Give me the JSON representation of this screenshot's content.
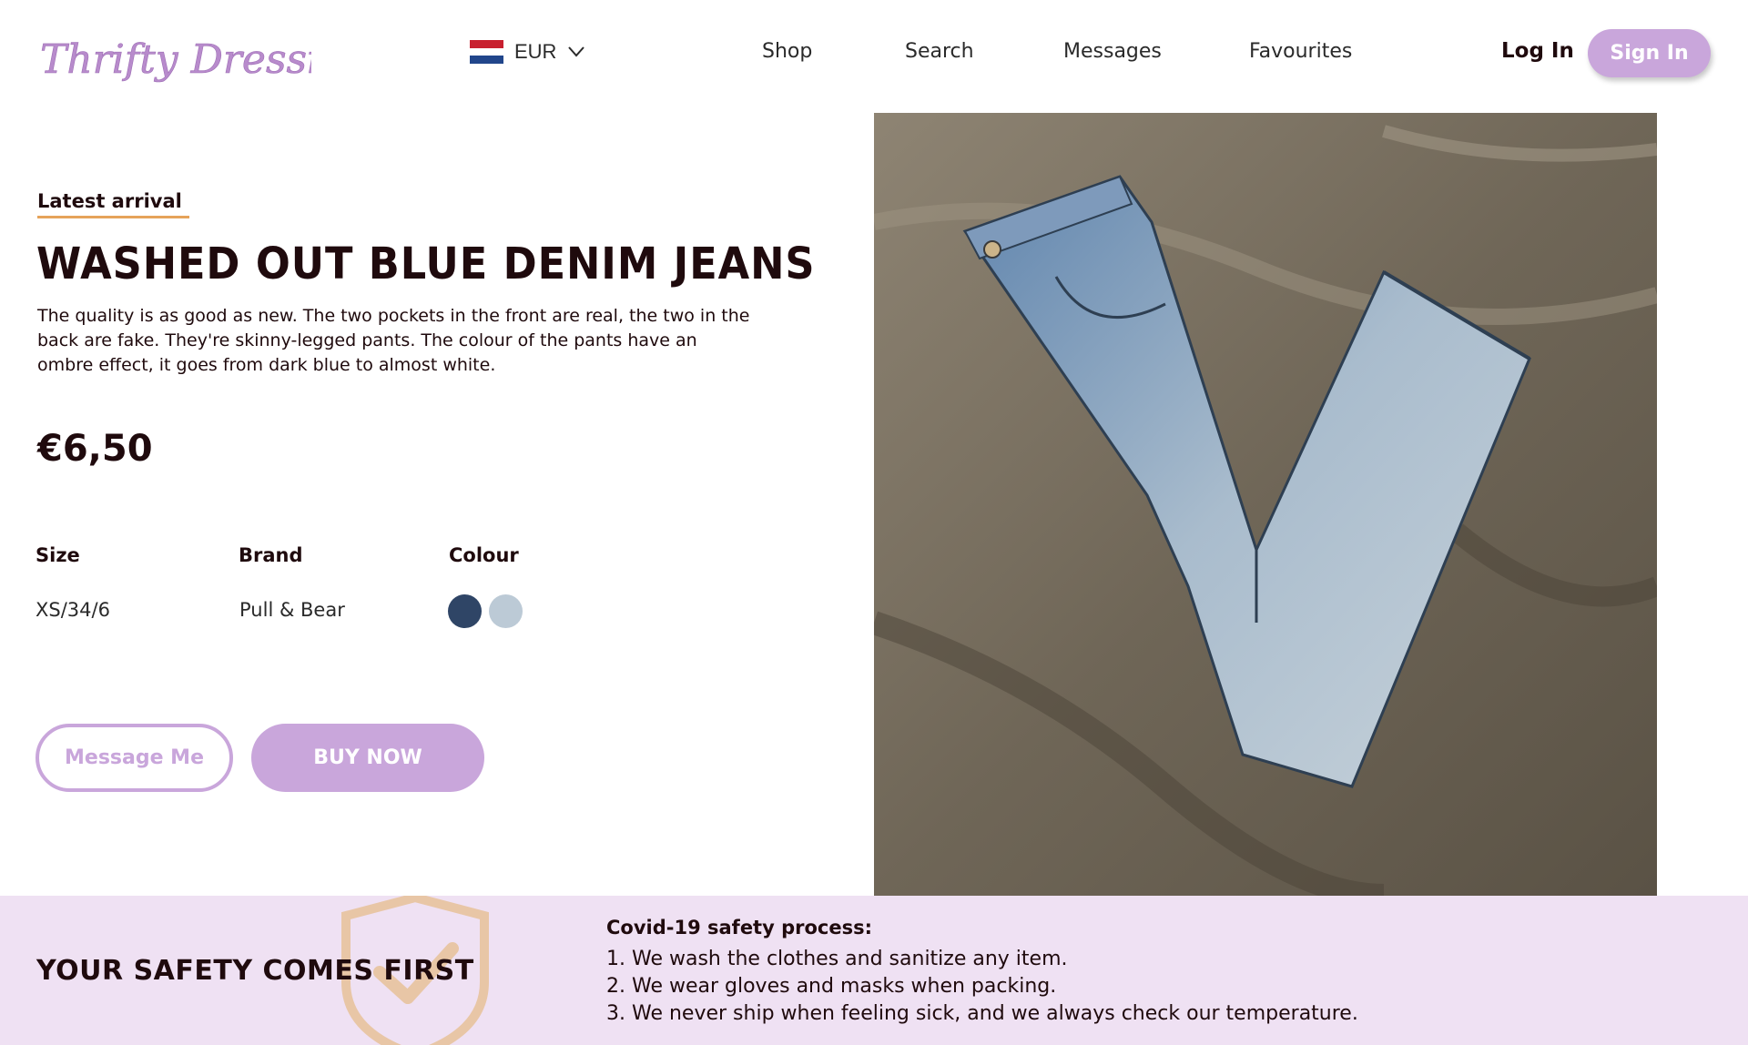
{
  "brand": {
    "logo_text": "Thrifty Dressing",
    "accent": "#c9a6db",
    "underline": "#e6a35a",
    "shield": "#e8c6a6"
  },
  "header": {
    "currency": {
      "label": "EUR",
      "flag": "netherlands-flag"
    },
    "nav": [
      "Shop",
      "Search",
      "Messages",
      "Favourites"
    ],
    "login_label": "Log In",
    "signin_label": "Sign In"
  },
  "product": {
    "tag": "Latest arrival",
    "title": "WASHED OUT BLUE DENIM JEANS",
    "description": "The quality is as good as new. The two pockets in the front are real, the two in the back are fake. They're skinny-legged pants. The colour of the pants have an ombre effect, it goes from dark blue to almost white.",
    "price": "€6,50",
    "attributes": {
      "size_label": "Size",
      "size_value": "XS/34/6",
      "brand_label": "Brand",
      "brand_value": "Pull & Bear",
      "colour_label": "Colour",
      "colours": [
        "#2f4566",
        "#bccad6"
      ]
    },
    "message_label": "Message Me",
    "buy_label": "BUY NOW"
  },
  "safety": {
    "title": "YOUR SAFETY COMES FIRST",
    "process_title": "Covid-19 safety process:",
    "steps": [
      "1. We wash the clothes and sanitize any item.",
      "2. We wear gloves and masks when packing.",
      "3. We never ship when feeling sick, and we always check our temperature."
    ]
  }
}
